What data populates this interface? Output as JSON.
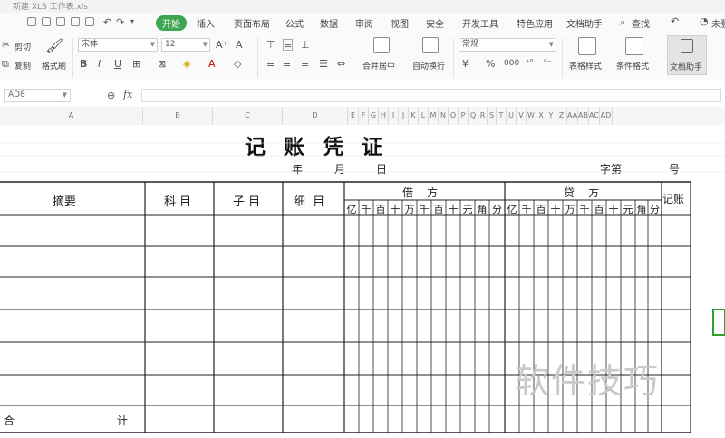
{
  "titlebar": {
    "doc_tab": "新建 XLS 工作表.xls"
  },
  "menu": {
    "items": [
      "开始",
      "插入",
      "页面布局",
      "公式",
      "数据",
      "审阅",
      "视图",
      "安全",
      "开发工具",
      "特色应用",
      "文档助手",
      "查找"
    ],
    "active": "开始"
  },
  "ribbon": {
    "cut": "剪切",
    "copy": "复制",
    "format_painter": "格式刷",
    "font_name": "宋体",
    "font_size": "12",
    "merge_center": "合并居中",
    "wrap_text": "自动换行",
    "number_format": "常规",
    "table_style": "表格样式",
    "cond_format": "条件格式",
    "doc_helper": "文档助手",
    "top_right": "未登"
  },
  "formula_bar": {
    "name_box": "AD8",
    "fx": "fx",
    "value": ""
  },
  "columns": [
    "A",
    "B",
    "C",
    "D",
    "E",
    "F",
    "G",
    "H",
    "I",
    "J",
    "K",
    "L",
    "M",
    "N",
    "O",
    "P",
    "Q",
    "R",
    "S",
    "T",
    "U",
    "V",
    "W",
    "X",
    "Y",
    "Z",
    "AA",
    "AB",
    "AC",
    "AD"
  ],
  "sheet": {
    "title": "记账凭证",
    "date_year": "年",
    "date_month": "月",
    "date_day": "日",
    "zi_di": "字第",
    "hao": "号",
    "headers": {
      "summary": "摘要",
      "account": "科 目",
      "sub_account": "子 目",
      "detail": "细  目",
      "debit": "借    方",
      "credit": "贷    方",
      "posted": "记账"
    },
    "digits": [
      "亿",
      "千",
      "百",
      "十",
      "万",
      "千",
      "百",
      "十",
      "元",
      "角",
      "分"
    ],
    "total_left": "合",
    "total_right": "计"
  },
  "watermark": "软件技巧"
}
